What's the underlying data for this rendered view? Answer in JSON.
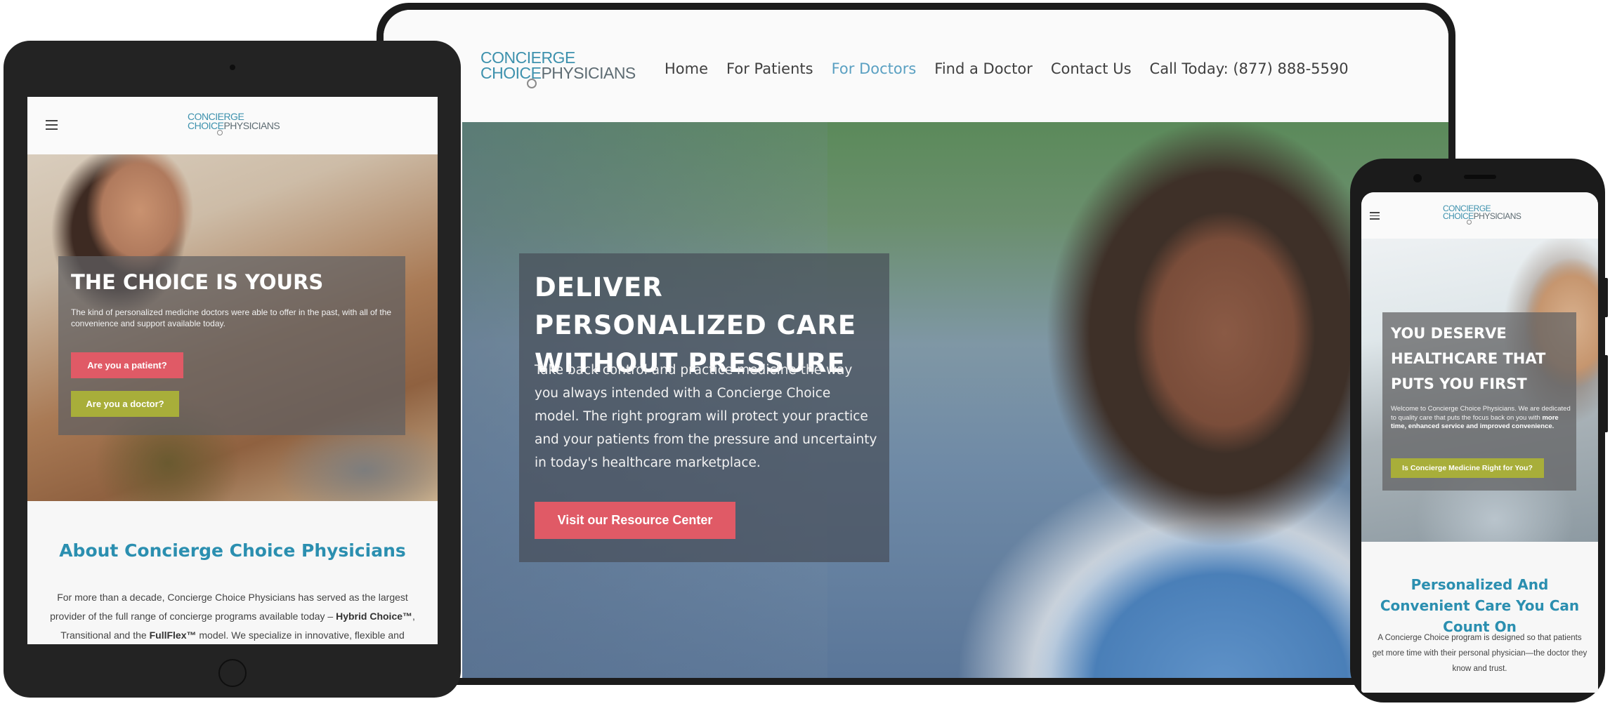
{
  "desktop": {
    "logo": {
      "line1": "CONCIERGE",
      "line2a": "CHOICE",
      "line2b": "PHYSICIANS"
    },
    "nav": [
      "Home",
      "For Patients",
      "For Doctors",
      "Find a Doctor",
      "Contact Us",
      "Call Today: (877) 888-5590"
    ],
    "active_nav": "For Doctors",
    "hero": {
      "title": "DELIVER PERSONALIZED CARE WITHOUT PRESSURE",
      "body": "Take back control and practice medicine the way you always intended with a Concierge Choice model. The right program will protect your practice and your patients from the pressure and uncertainty in today's healthcare marketplace.",
      "button": "Visit our Resource Center"
    }
  },
  "tablet": {
    "logo": {
      "line1": "CONCIERGE",
      "line2a": "CHOICE",
      "line2b": "PHYSICIANS"
    },
    "hero": {
      "title": "THE CHOICE IS YOURS",
      "body": "The kind of personalized medicine doctors were able to offer in the past, with all of the convenience and support available today.",
      "patient_button": "Are you a patient?",
      "doctor_button": "Are you a doctor?"
    },
    "about": {
      "title": "About Concierge Choice Physicians",
      "body_pre": "For more than a decade, Concierge Choice Physicians has served as the largest provider of the full range of concierge programs available today – ",
      "body_bold1": "Hybrid Choice™",
      "body_mid": ", Transitional and the ",
      "body_bold2": "FullFlex™",
      "body_post": " model. We specialize in innovative, flexible and"
    }
  },
  "phone": {
    "logo": {
      "line1": "CONCIERGE",
      "line2a": "CHOICE",
      "line2b": "PHYSICIANS"
    },
    "hero": {
      "title": "YOU DESERVE HEALTHCARE THAT PUTS YOU FIRST",
      "body_pre": "Welcome to Concierge Choice Physicians. We are dedicated to quality care that puts the focus back on you with ",
      "body_bold": "more time, enhanced service and improved convenience.",
      "button": "Is Concierge Medicine Right for You?"
    },
    "section": {
      "title": "Personalized And Convenient Care You Can Count On",
      "body": "A Concierge Choice program is designed so that patients get more time with their personal physician—the doctor they know and trust."
    }
  },
  "colors": {
    "brand_teal": "#3d91ad",
    "accent_pink": "#e05a66",
    "accent_olive": "#a8ae3a",
    "nav_active": "#5aa0c2"
  }
}
